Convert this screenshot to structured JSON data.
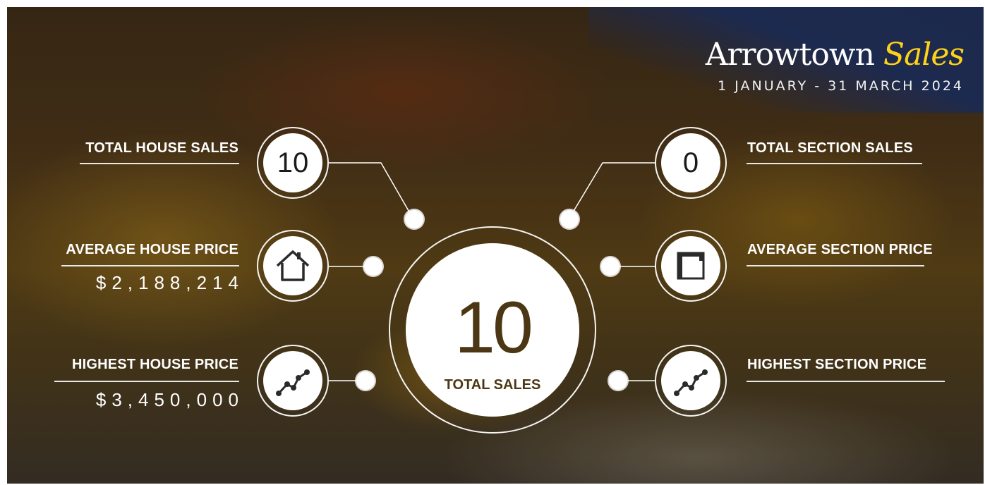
{
  "header": {
    "title_main": "Arrowtown",
    "title_accent": "Sales",
    "date_range": "1 JANUARY - 31 MARCH 2024"
  },
  "center": {
    "total": "10",
    "label": "TOTAL SALES"
  },
  "left": {
    "house_sales_label": "TOTAL HOUSE SALES",
    "house_sales_value": "10",
    "avg_house_label": "AVERAGE HOUSE PRICE",
    "avg_house_value": "$2,188,214",
    "high_house_label": "HIGHEST HOUSE PRICE",
    "high_house_value": "$3,450,000"
  },
  "right": {
    "section_sales_label": "TOTAL SECTION SALES",
    "section_sales_value": "0",
    "avg_section_label": "AVERAGE SECTION PRICE",
    "high_section_label": "HIGHEST SECTION PRICE"
  },
  "icons": {
    "house": "house-icon",
    "section": "section-plan-icon",
    "trend": "trend-line-icon"
  },
  "colors": {
    "accent": "#ffd21a",
    "brown": "#4b3714",
    "white": "#ffffff"
  }
}
